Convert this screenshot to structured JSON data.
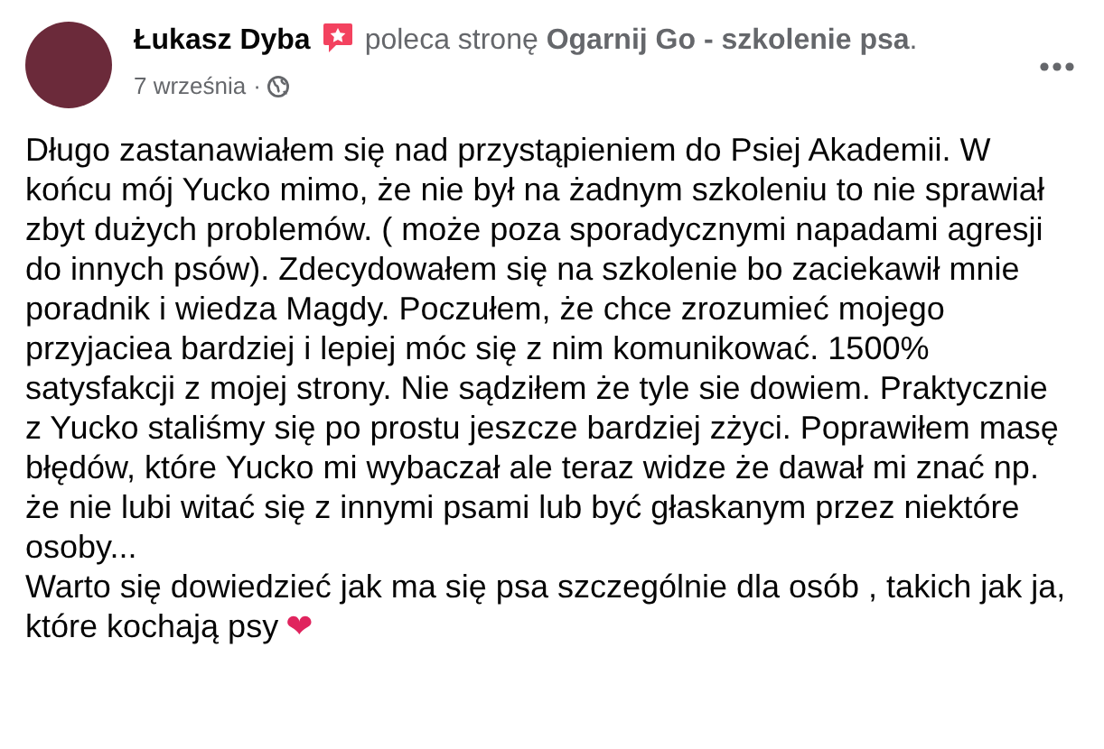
{
  "post": {
    "author": "Łukasz Dyba",
    "action": "poleca stronę **Ogarnij Go - szkolenie psa**.",
    "date": "7 września",
    "separator": "·",
    "paragraphs": [
      "Długo zastanawiałem się nad przystąpieniem do Psiej Akademii. W końcu mój Yucko mimo, że nie był na żadnym szkoleniu to nie sprawiał  zbyt dużych problemów. ( może poza sporadycznymi napadami agresji do innych psów). Zdecydowałem się na szkolenie bo zaciekawił mnie poradnik i wiedza Magdy. Poczułem, że chce zrozumieć mojego przyjaciea bardziej i lepiej móc się z nim komunikować. 1500% satysfakcji z mojej strony. Nie sądziłem że tyle sie dowiem. Praktycznie z Yucko staliśmy się po prostu jeszcze bardziej zżyci. Poprawiłem masę błędów, które Yucko mi wybaczał ale teraz widze że dawał mi znać np. że nie lubi witać się z innymi psami lub być głaskanym przez niektóre osoby...",
      "Warto się dowiedzieć jak ma się psa szczególnie dla osób , takich jak ja,  które kochają psy"
    ],
    "emoji": "❤"
  }
}
